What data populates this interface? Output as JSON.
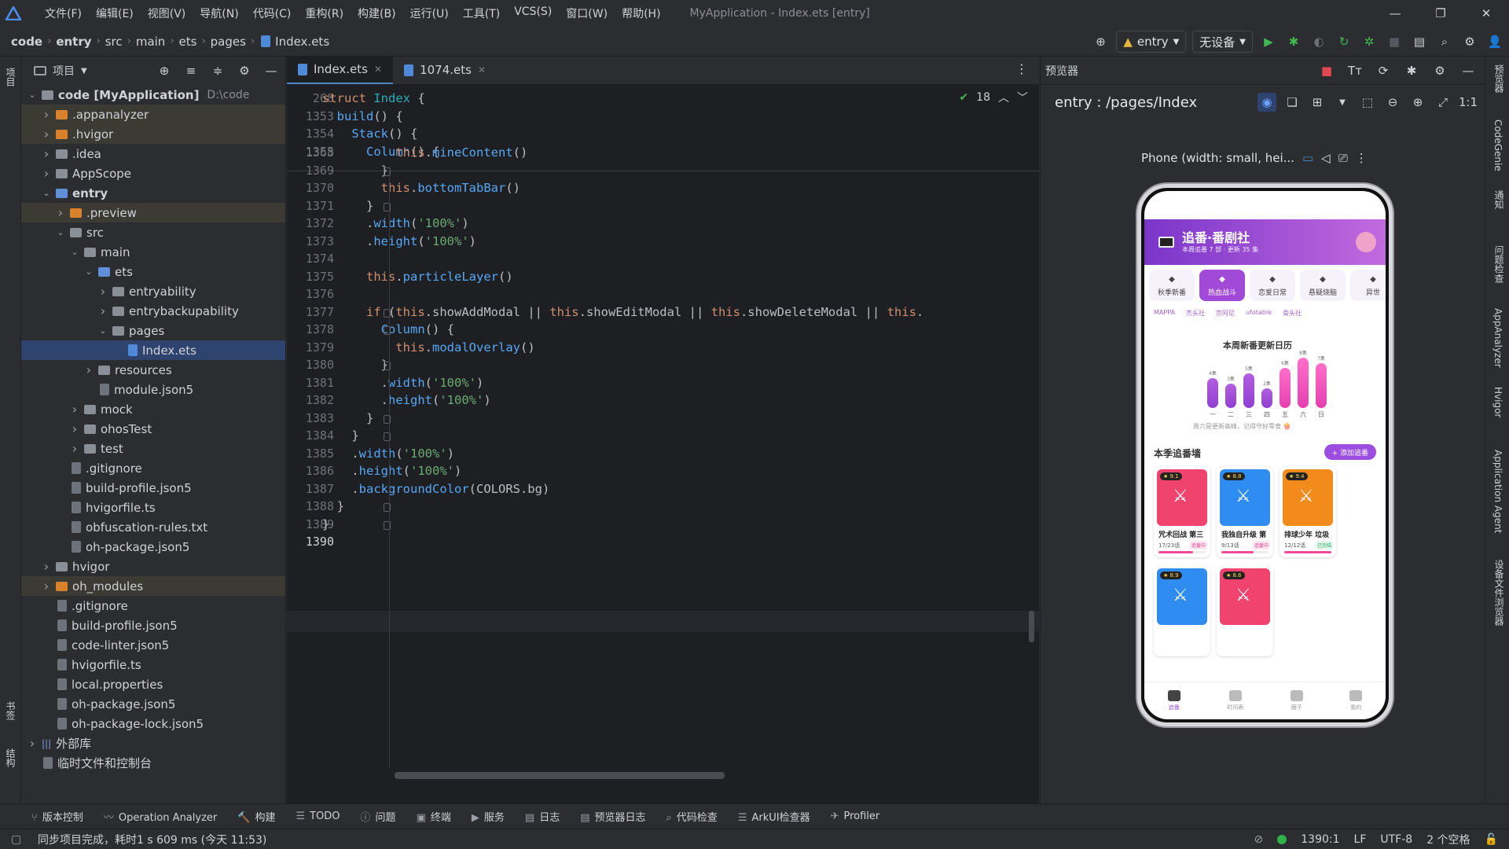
{
  "titlebar": {
    "menu": [
      "文件(F)",
      "编辑(E)",
      "视图(V)",
      "导航(N)",
      "代码(C)",
      "重构(R)",
      "构建(B)",
      "运行(U)",
      "工具(T)",
      "VCS(S)",
      "窗口(W)",
      "帮助(H)"
    ],
    "window_title": "MyApplication - Index.ets [entry]"
  },
  "navbar": {
    "crumbs": [
      "code",
      "entry",
      "src",
      "main",
      "ets",
      "pages",
      "Index.ets"
    ],
    "run_config": "entry",
    "device": "无设备"
  },
  "left_stripe": {
    "project_label": "项目",
    "bookmarks_label": "书签",
    "structure_label": "结构"
  },
  "project": {
    "title": "项目",
    "tree": [
      {
        "label": "code [MyApplication]",
        "extra": "D:\\code",
        "depth": 0,
        "arrow": "v",
        "icon": "folder",
        "bold": true
      },
      {
        "label": ".appanalyzer",
        "depth": 1,
        "arrow": ">",
        "icon": "folder-orange",
        "hl": true
      },
      {
        "label": ".hvigor",
        "depth": 1,
        "arrow": ">",
        "icon": "folder-orange",
        "hl": true
      },
      {
        "label": ".idea",
        "depth": 1,
        "arrow": ">",
        "icon": "folder"
      },
      {
        "label": "AppScope",
        "depth": 1,
        "arrow": ">",
        "icon": "folder"
      },
      {
        "label": "entry",
        "depth": 1,
        "arrow": "v",
        "icon": "folder-blue",
        "bold": true
      },
      {
        "label": ".preview",
        "depth": 2,
        "arrow": ">",
        "icon": "folder-orange",
        "hl": true
      },
      {
        "label": "src",
        "depth": 2,
        "arrow": "v",
        "icon": "folder"
      },
      {
        "label": "main",
        "depth": 3,
        "arrow": "v",
        "icon": "folder"
      },
      {
        "label": "ets",
        "depth": 4,
        "arrow": "v",
        "icon": "folder-blue"
      },
      {
        "label": "entryability",
        "depth": 5,
        "arrow": ">",
        "icon": "folder"
      },
      {
        "label": "entrybackupability",
        "depth": 5,
        "arrow": ">",
        "icon": "folder"
      },
      {
        "label": "pages",
        "depth": 5,
        "arrow": "v",
        "icon": "folder"
      },
      {
        "label": "Index.ets",
        "depth": 6,
        "arrow": "",
        "icon": "file-ets",
        "sel": true
      },
      {
        "label": "resources",
        "depth": 4,
        "arrow": ">",
        "icon": "folder"
      },
      {
        "label": "module.json5",
        "depth": 4,
        "arrow": "",
        "icon": "file"
      },
      {
        "label": "mock",
        "depth": 3,
        "arrow": ">",
        "icon": "folder"
      },
      {
        "label": "ohosTest",
        "depth": 3,
        "arrow": ">",
        "icon": "folder"
      },
      {
        "label": "test",
        "depth": 3,
        "arrow": ">",
        "icon": "folder"
      },
      {
        "label": ".gitignore",
        "depth": 2,
        "arrow": "",
        "icon": "file"
      },
      {
        "label": "build-profile.json5",
        "depth": 2,
        "arrow": "",
        "icon": "file"
      },
      {
        "label": "hvigorfile.ts",
        "depth": 2,
        "arrow": "",
        "icon": "file"
      },
      {
        "label": "obfuscation-rules.txt",
        "depth": 2,
        "arrow": "",
        "icon": "file"
      },
      {
        "label": "oh-package.json5",
        "depth": 2,
        "arrow": "",
        "icon": "file"
      },
      {
        "label": "hvigor",
        "depth": 1,
        "arrow": ">",
        "icon": "folder"
      },
      {
        "label": "oh_modules",
        "depth": 1,
        "arrow": ">",
        "icon": "folder-orange",
        "hl": true
      },
      {
        "label": ".gitignore",
        "depth": 1,
        "arrow": "",
        "icon": "file"
      },
      {
        "label": "build-profile.json5",
        "depth": 1,
        "arrow": "",
        "icon": "file"
      },
      {
        "label": "code-linter.json5",
        "depth": 1,
        "arrow": "",
        "icon": "file"
      },
      {
        "label": "hvigorfile.ts",
        "depth": 1,
        "arrow": "",
        "icon": "file"
      },
      {
        "label": "local.properties",
        "depth": 1,
        "arrow": "",
        "icon": "file"
      },
      {
        "label": "oh-package.json5",
        "depth": 1,
        "arrow": "",
        "icon": "file"
      },
      {
        "label": "oh-package-lock.json5",
        "depth": 1,
        "arrow": "",
        "icon": "file"
      },
      {
        "label": "外部库",
        "depth": 0,
        "arrow": ">",
        "icon": "lib"
      },
      {
        "label": "临时文件和控制台",
        "depth": 0,
        "arrow": "",
        "icon": "file"
      }
    ]
  },
  "editor": {
    "tabs": [
      {
        "label": "Index.ets",
        "active": true
      },
      {
        "label": "1074.ets",
        "active": false
      }
    ],
    "inspection_count": "18",
    "sticky_lines": [
      {
        "n": "268",
        "html": "<span class='kw'>struct</span> <span class='ty'>Index</span> {"
      },
      {
        "n": "1353",
        "html": "  <span class='fn'>build</span>() {"
      },
      {
        "n": "1354",
        "html": "    <span class='fn'>Stack</span>() {"
      },
      {
        "n": "1355",
        "html": "      <span class='fn'>Column</span>() {"
      }
    ],
    "lines": [
      {
        "n": "1368",
        "html": "          <span class='kw'>this</span>.<span class='fn'>mineContent</span>()"
      },
      {
        "n": "1369",
        "html": "        }"
      },
      {
        "n": "1370",
        "html": "        <span class='kw'>this</span>.<span class='fn'>bottomTabBar</span>()"
      },
      {
        "n": "1371",
        "html": "      }"
      },
      {
        "n": "1372",
        "html": "      .<span class='fn'>width</span>(<span class='str'>'100%'</span>)"
      },
      {
        "n": "1373",
        "html": "      .<span class='fn'>height</span>(<span class='str'>'100%'</span>)"
      },
      {
        "n": "1374",
        "html": ""
      },
      {
        "n": "1375",
        "html": "      <span class='kw'>this</span>.<span class='fn'>particleLayer</span>()"
      },
      {
        "n": "1376",
        "html": ""
      },
      {
        "n": "1377",
        "html": "      <span class='kw'>if</span> (<span class='kw'>this</span>.showAddModal || <span class='kw'>this</span>.showEditModal || <span class='kw'>this</span>.showDeleteModal || <span class='kw'>this</span>."
      },
      {
        "n": "1378",
        "html": "        <span class='fn'>Column</span>() {"
      },
      {
        "n": "1379",
        "html": "          <span class='kw'>this</span>.<span class='fn'>modalOverlay</span>()"
      },
      {
        "n": "1380",
        "html": "        }"
      },
      {
        "n": "1381",
        "html": "        .<span class='fn'>width</span>(<span class='str'>'100%'</span>)"
      },
      {
        "n": "1382",
        "html": "        .<span class='fn'>height</span>(<span class='str'>'100%'</span>)"
      },
      {
        "n": "1383",
        "html": "      }"
      },
      {
        "n": "1384",
        "html": "    }"
      },
      {
        "n": "1385",
        "html": "    .<span class='fn'>width</span>(<span class='str'>'100%'</span>)"
      },
      {
        "n": "1386",
        "html": "    .<span class='fn'>height</span>(<span class='str'>'100%'</span>)"
      },
      {
        "n": "1387",
        "html": "    .<span class='fn'>backgroundColor</span>(COLORS.bg)"
      },
      {
        "n": "1388",
        "html": "  }"
      },
      {
        "n": "1389",
        "html": "}"
      },
      {
        "n": "1390",
        "html": ""
      }
    ]
  },
  "preview": {
    "title": "预览器",
    "route": "entry : /pages/Index",
    "device_label": "Phone (width: small, hei...",
    "app": {
      "title": "追番·番剧社",
      "subtitle": "本周追番 7 部 · 更新 35 集",
      "chips": [
        {
          "label": "秋季新番",
          "on": false
        },
        {
          "label": "热血战斗",
          "on": true
        },
        {
          "label": "恋爱日常",
          "on": false
        },
        {
          "label": "悬疑烧脑",
          "on": false
        },
        {
          "label": "异世",
          "on": false
        }
      ],
      "tags": [
        "MAPPA",
        "杰头社",
        "京阿尼",
        "ufotable",
        "骨头社"
      ],
      "calendar_title": "本周新番更新日历",
      "calendar": {
        "days": [
          "一",
          "二",
          "三",
          "四",
          "五",
          "六",
          "日"
        ],
        "values": [
          4,
          3,
          5,
          2,
          6,
          8,
          7
        ],
        "value_labels": [
          "4集",
          "3集",
          "5集",
          "2集",
          "6集",
          "8集",
          "7集"
        ]
      },
      "calendar_note": "周六是更新高峰，记得守好零食 🍿",
      "wall_title": "本季追番墙",
      "add_button": "+ 添加追番",
      "cards": [
        {
          "name": "咒术回战 第三",
          "rating": "★ 9.1",
          "ep": "17/23话",
          "status": "追番中",
          "progress": 0.74,
          "color": "#f0436e"
        },
        {
          "name": "我独自升级 第",
          "rating": "★ 8.8",
          "ep": "9/13话",
          "status": "追番中",
          "progress": 0.69,
          "color": "#2f8cf0"
        },
        {
          "name": "排球少年 垃圾",
          "rating": "★ 9.4",
          "ep": "12/12话",
          "status": "已完结",
          "progress": 1.0,
          "color": "#f28a1c"
        },
        {
          "name": "",
          "rating": "★ 8.9",
          "ep": "",
          "status": "",
          "progress": 0,
          "color": "#2f8cf0"
        },
        {
          "name": "",
          "rating": "★ 8.6",
          "ep": "",
          "status": "",
          "progress": 0,
          "color": "#f0436e"
        }
      ],
      "tabbar": [
        {
          "label": "追番",
          "on": true
        },
        {
          "label": "时间表",
          "on": false
        },
        {
          "label": "圈子",
          "on": false
        },
        {
          "label": "我的",
          "on": false
        }
      ]
    }
  },
  "right_stripe": [
    "预览器",
    "CodeGenie",
    "通知",
    "问题检查",
    "AppAnalyzer",
    "Hvigor",
    "Application Agent",
    "设备文件浏览器"
  ],
  "bottombar": [
    "版本控制",
    "Operation Analyzer",
    "构建",
    "TODO",
    "问题",
    "终端",
    "服务",
    "日志",
    "预览器日志",
    "代码检查",
    "ArkUI检查器",
    "Profiler"
  ],
  "statusbar": {
    "message": "同步项目完成，耗时1 s 609 ms (今天 11:53)",
    "position": "1390:1",
    "line_sep": "LF",
    "encoding": "UTF-8",
    "indent": "2 个空格"
  }
}
